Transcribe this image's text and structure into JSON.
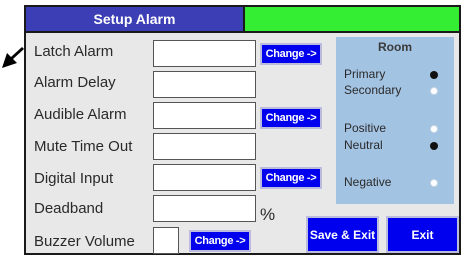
{
  "title": "Setup Alarm",
  "rows": [
    {
      "label": "Latch Alarm",
      "value": ""
    },
    {
      "label": "Alarm Delay",
      "value": ""
    },
    {
      "label": "Audible Alarm",
      "value": ""
    },
    {
      "label": "Mute Time Out",
      "value": ""
    },
    {
      "label": "Digital Input",
      "value": ""
    },
    {
      "label": "Deadband",
      "value": "",
      "unit": "%"
    },
    {
      "label": "Buzzer Volume",
      "value": ""
    }
  ],
  "change_label": "Change ->",
  "room": {
    "title": "Room",
    "options": [
      {
        "label": "Primary",
        "selected": true
      },
      {
        "label": "Secondary",
        "selected": false
      },
      {
        "label": "Positive",
        "selected": false
      },
      {
        "label": "Neutral",
        "selected": true
      },
      {
        "label": "Negative",
        "selected": false
      }
    ]
  },
  "buttons": {
    "save_exit": "Save & Exit",
    "exit": "Exit"
  },
  "colors": {
    "title_bg": "#3b3eb4",
    "status_ok": "#33ee33",
    "button_bg": "#0000ee",
    "room_bg": "#a3c3e3"
  }
}
